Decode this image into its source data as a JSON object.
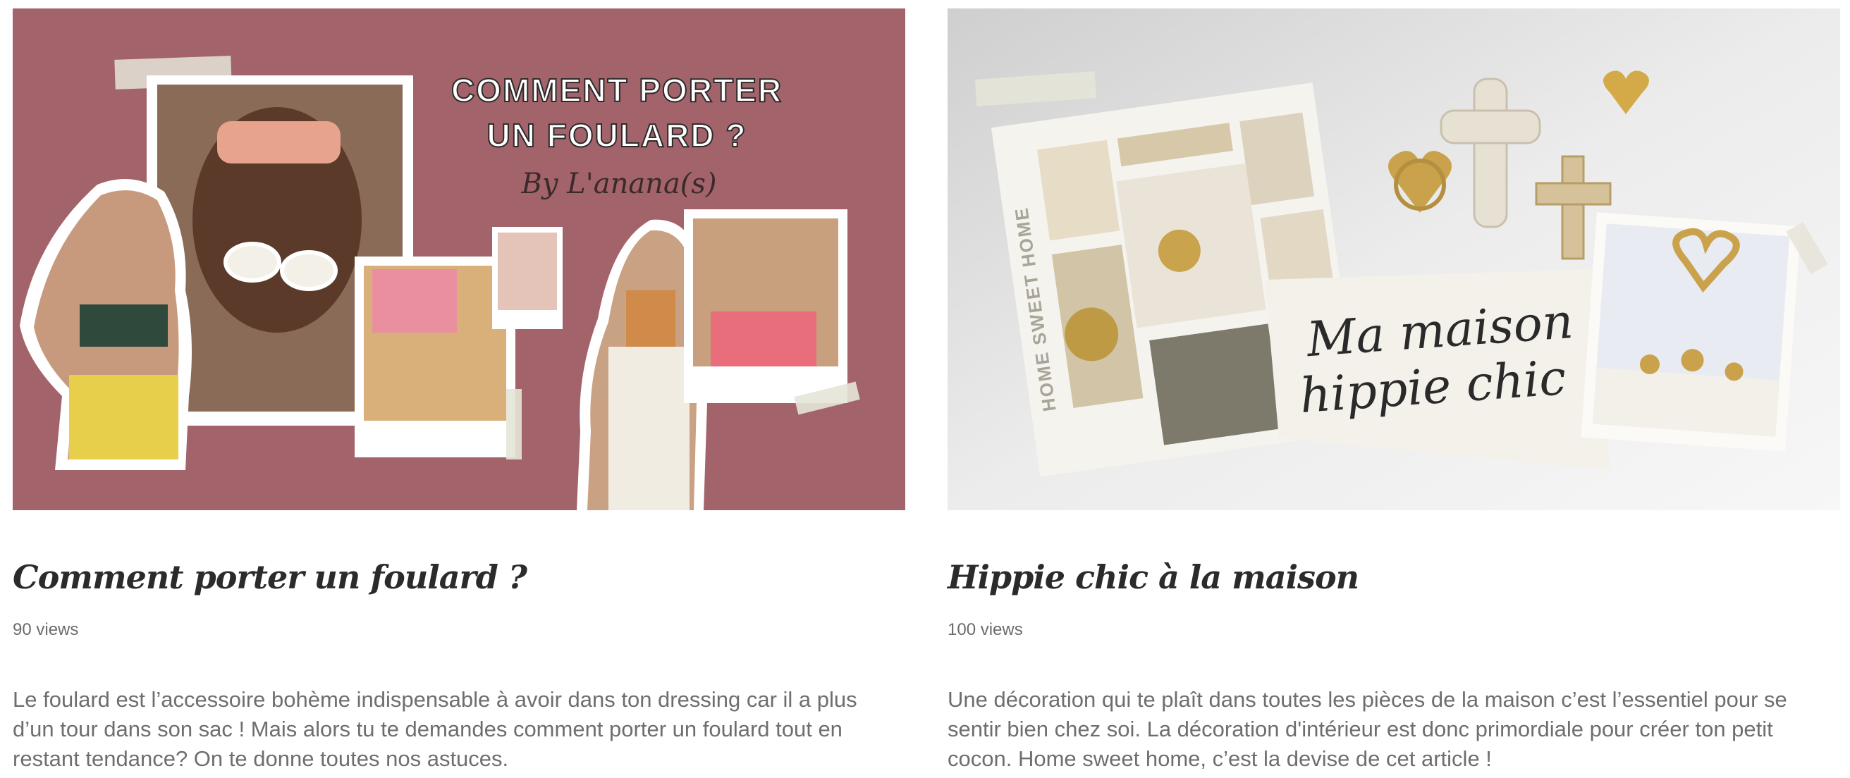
{
  "posts": [
    {
      "image": {
        "headline_line1": "COMMENT PORTER",
        "headline_line2": "UN FOULARD ?",
        "signature": "By L'anana(s)",
        "background_color": "#a3636a"
      },
      "title": "Comment porter un foulard ?",
      "views": "90 views",
      "excerpt": "Le foulard est l’accessoire bohème indispensable à avoir dans ton dressing car il a plus d’un tour dans son sac ! Mais alors tu te demandes comment porter un foulard tout en restant tendance? On te donne toutes nos astuces."
    },
    {
      "image": {
        "side_text": "HOME SWEET HOME",
        "script_line1": "Ma maison",
        "script_line2": "hippie chic",
        "background_color": "#e9e9e9"
      },
      "title": "Hippie chic à la maison",
      "views": "100 views",
      "excerpt": "Une décoration qui te plaît dans toutes les pièces de la maison c’est l’essentiel pour se sentir bien chez soi. La décoration d'intérieur est donc primordiale pour créer ton petit cocon. Home sweet home, c’est la devise de cet article !"
    }
  ]
}
